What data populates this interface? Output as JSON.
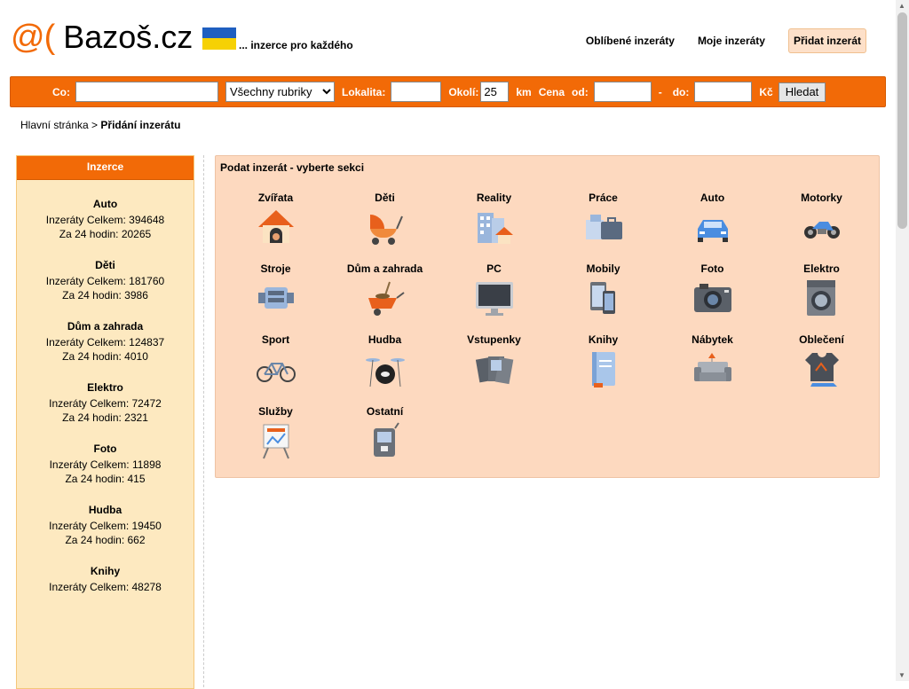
{
  "logo": {
    "at": "@(",
    "name": "Bazoš.cz"
  },
  "tagline": "... inzerce pro každého",
  "topnav": {
    "favorites": "Oblíbené inzeráty",
    "mine": "Moje inzeráty",
    "add": "Přidat inzerát"
  },
  "search": {
    "co_label": "Co:",
    "co_value": "",
    "category_selected": "Všechny rubriky",
    "lokalita_label": "Lokalita:",
    "lokalita_value": "",
    "okoli_label": "Okolí:",
    "okoli_value": "25",
    "km_label": "km",
    "cena_label": "Cena",
    "od_label": "od:",
    "od_value": "",
    "dash": "-",
    "do_label": "do:",
    "do_value": "",
    "currency": "Kč",
    "button": "Hledat"
  },
  "breadcrumb": {
    "home": "Hlavní stránka",
    "sep": " > ",
    "current": "Přidání inzerátu"
  },
  "sidebar": {
    "title": "Inzerce",
    "items": [
      {
        "name": "Auto",
        "total": "Inzeráty Celkem: 394648",
        "day": "Za 24 hodin: 20265"
      },
      {
        "name": "Děti",
        "total": "Inzeráty Celkem: 181760",
        "day": "Za 24 hodin: 3986"
      },
      {
        "name": "Dům a zahrada",
        "total": "Inzeráty Celkem: 124837",
        "day": "Za 24 hodin: 4010"
      },
      {
        "name": "Elektro",
        "total": "Inzeráty Celkem: 72472",
        "day": "Za 24 hodin: 2321"
      },
      {
        "name": "Foto",
        "total": "Inzeráty Celkem: 11898",
        "day": "Za 24 hodin: 415"
      },
      {
        "name": "Hudba",
        "total": "Inzeráty Celkem: 19450",
        "day": "Za 24 hodin: 662"
      },
      {
        "name": "Knihy",
        "total": "Inzeráty Celkem: 48278",
        "day": ""
      }
    ]
  },
  "panel": {
    "title": "Podat inzerát - vyberte sekci",
    "sections": [
      {
        "label": "Zvířata",
        "icon": "doghouse-icon"
      },
      {
        "label": "Děti",
        "icon": "stroller-icon"
      },
      {
        "label": "Reality",
        "icon": "buildings-icon"
      },
      {
        "label": "Práce",
        "icon": "briefcase-icon"
      },
      {
        "label": "Auto",
        "icon": "car-icon"
      },
      {
        "label": "Motorky",
        "icon": "motorcycle-icon"
      },
      {
        "label": "Stroje",
        "icon": "engine-icon"
      },
      {
        "label": "Dům a zahrada",
        "icon": "wheelbarrow-icon"
      },
      {
        "label": "PC",
        "icon": "monitor-icon"
      },
      {
        "label": "Mobily",
        "icon": "phone-icon"
      },
      {
        "label": "Foto",
        "icon": "camera-icon"
      },
      {
        "label": "Elektro",
        "icon": "washing-machine-icon"
      },
      {
        "label": "Sport",
        "icon": "bicycle-icon"
      },
      {
        "label": "Hudba",
        "icon": "drums-icon"
      },
      {
        "label": "Vstupenky",
        "icon": "tickets-icon"
      },
      {
        "label": "Knihy",
        "icon": "book-icon"
      },
      {
        "label": "Nábytek",
        "icon": "sofa-icon"
      },
      {
        "label": "Oblečení",
        "icon": "clothes-icon"
      },
      {
        "label": "Služby",
        "icon": "easel-icon"
      },
      {
        "label": "Ostatní",
        "icon": "device-icon"
      }
    ]
  },
  "colors": {
    "accent": "#f26a07",
    "panel": "#fdd9bf",
    "sidebar": "#fde9c0"
  }
}
